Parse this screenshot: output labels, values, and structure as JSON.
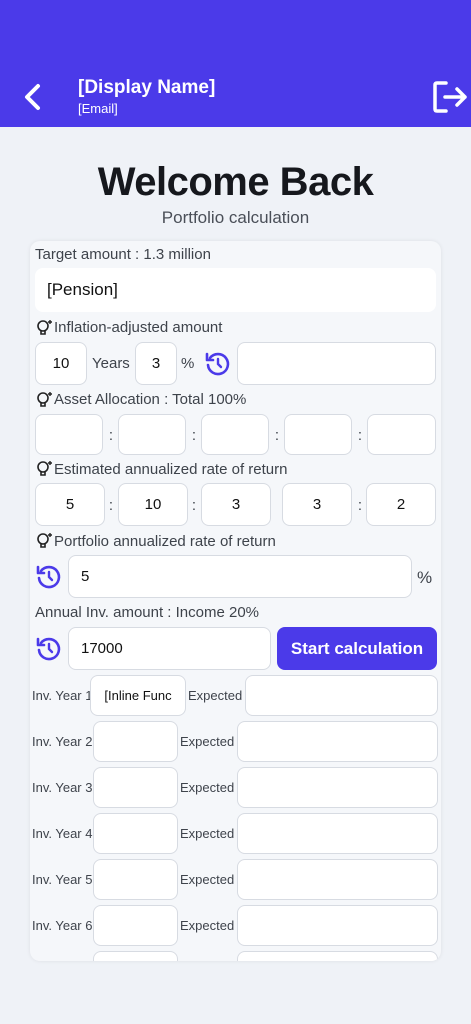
{
  "header": {
    "name": "[Display Name]",
    "email": "[Email]"
  },
  "welcome": {
    "title": "Welcome Back",
    "subtitle": "Portfolio calculation"
  },
  "target": {
    "label": "Target amount : 1.3 million",
    "value": "[Pension]"
  },
  "inflation": {
    "label": "Inflation-adjusted amount",
    "years": "10",
    "years_unit": "Years",
    "rate": "3",
    "rate_unit": "%",
    "result": ""
  },
  "allocation": {
    "label": "Asset Allocation",
    "total": ": Total 100%",
    "values": [
      "",
      "",
      "",
      "",
      ""
    ]
  },
  "estimated": {
    "label": "Estimated annualized rate of return",
    "values": [
      "5",
      "10",
      "3",
      "3",
      "2"
    ]
  },
  "portfolio": {
    "label": "Portfolio annualized rate of return",
    "value": "5",
    "unit": "%"
  },
  "annual": {
    "label": "Annual Inv. amount : Income 20%",
    "value": "17000",
    "button": "Start calculation"
  },
  "years": [
    {
      "label": "Inv. Year 1",
      "value": "[Inline Func",
      "expected_label": "Expected",
      "expected": ""
    },
    {
      "label": "Inv. Year 2",
      "value": "",
      "expected_label": "Expected",
      "expected": ""
    },
    {
      "label": "Inv. Year 3",
      "value": "",
      "expected_label": "Expected",
      "expected": ""
    },
    {
      "label": "Inv. Year 4",
      "value": "",
      "expected_label": "Expected",
      "expected": ""
    },
    {
      "label": "Inv. Year 5",
      "value": "",
      "expected_label": "Expected",
      "expected": ""
    },
    {
      "label": "Inv. Year 6",
      "value": "",
      "expected_label": "Expected",
      "expected": ""
    }
  ],
  "colors": {
    "accent": "#4b3ae9",
    "background": "#eff2f7"
  },
  "icons": {
    "back": "chevron-left-icon",
    "logout": "logout-icon",
    "tip": "lightbulb-icon",
    "reset": "refresh-icon"
  }
}
